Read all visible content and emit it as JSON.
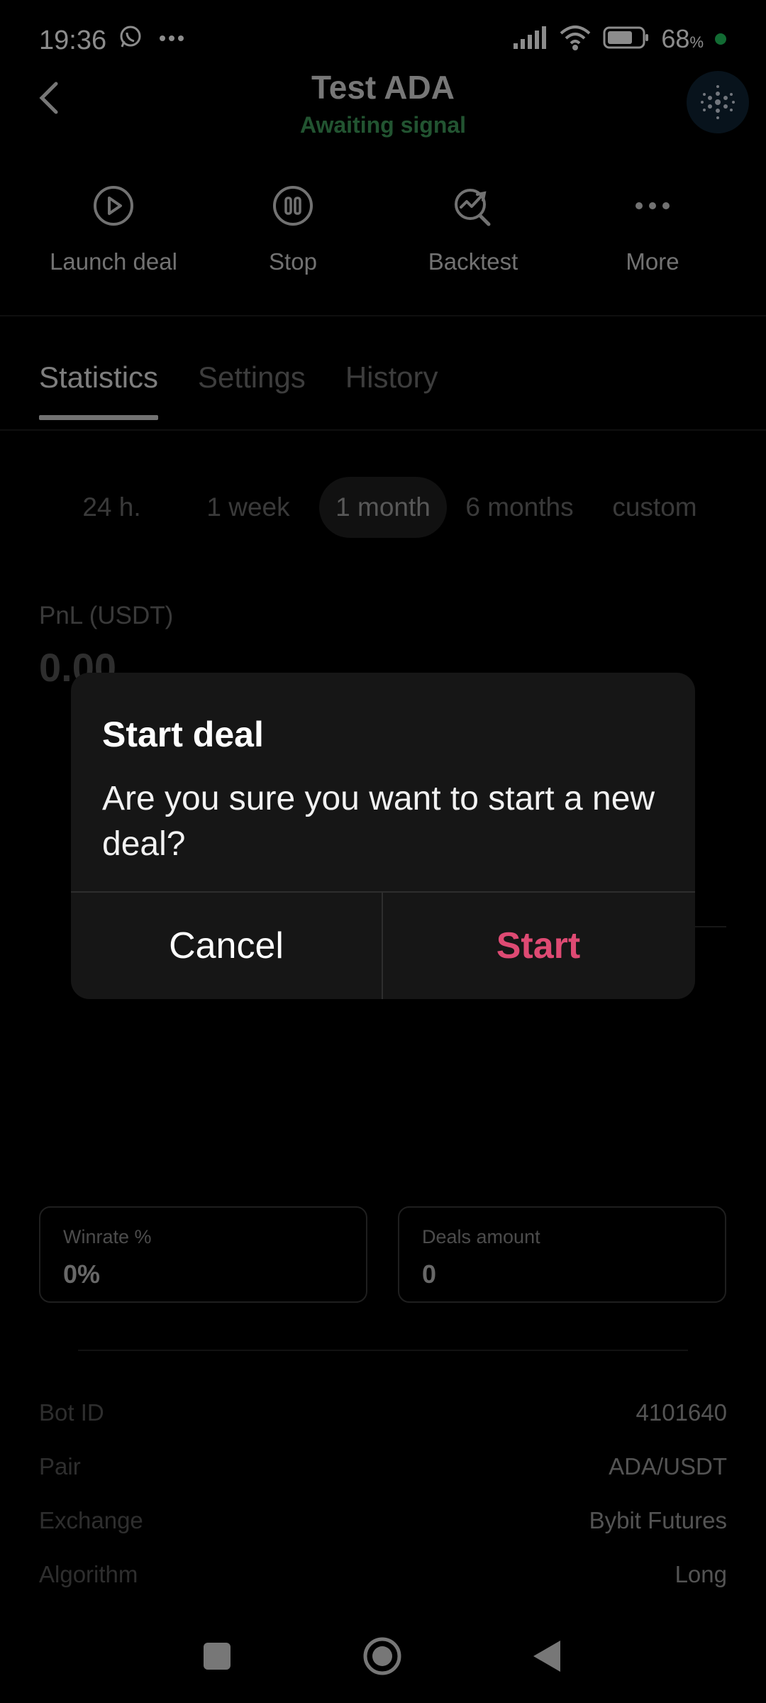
{
  "status_bar": {
    "time": "19:36",
    "battery": "68",
    "battery_unit": "%"
  },
  "header": {
    "title": "Test ADA",
    "status": "Awaiting signal"
  },
  "actions": [
    {
      "label": "Launch deal",
      "icon": "play-circle-icon"
    },
    {
      "label": "Stop",
      "icon": "pause-circle-icon"
    },
    {
      "label": "Backtest",
      "icon": "backtest-icon"
    },
    {
      "label": "More",
      "icon": "more-dots-icon"
    }
  ],
  "tabs": [
    {
      "label": "Statistics",
      "active": true
    },
    {
      "label": "Settings",
      "active": false
    },
    {
      "label": "History",
      "active": false
    }
  ],
  "periods": [
    {
      "label": "24 h.",
      "active": false
    },
    {
      "label": "1 week",
      "active": false
    },
    {
      "label": "1 month",
      "active": true
    },
    {
      "label": "6 months",
      "active": false
    },
    {
      "label": "custom",
      "active": false
    }
  ],
  "pnl": {
    "label": "PnL (USDT)",
    "value": "0.00"
  },
  "cards": {
    "winrate": {
      "label": "Winrate %",
      "value": "0%"
    },
    "deals": {
      "label": "Deals amount",
      "value": "0"
    }
  },
  "info": {
    "bot_id": {
      "key": "Bot ID",
      "value": "4101640"
    },
    "pair": {
      "key": "Pair",
      "value": "ADA/USDT"
    },
    "exchange": {
      "key": "Exchange",
      "value": "Bybit Futures"
    },
    "algorithm": {
      "key": "Algorithm",
      "value": "Long"
    }
  },
  "dialog": {
    "title": "Start deal",
    "message": "Are you sure you want to start a new deal?",
    "cancel_label": "Cancel",
    "confirm_label": "Start"
  },
  "colors": {
    "accent_green": "#3f9a5a",
    "confirm_pink": "#de4a73",
    "background": "#000000",
    "dialog_bg": "#161616"
  }
}
